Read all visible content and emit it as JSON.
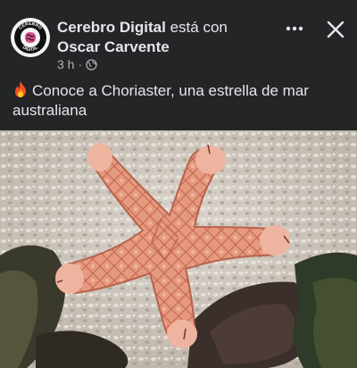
{
  "post": {
    "author": "Cerebro Digital",
    "with_text": "está con",
    "tagged": "Oscar Carvente",
    "time": "3 h",
    "dot": "·",
    "caption": "Conoce a Choriaster, una estrella de mar australiana"
  },
  "avatar": {
    "logo_top": "CEREBRO",
    "logo_bottom": "DIGITAL"
  },
  "icons": {
    "more": "more-options-icon",
    "close": "close-icon",
    "audience": "globe-icon",
    "emoji": "fire-emoji"
  },
  "colors": {
    "background": "#242526",
    "text": "#e4e6eb",
    "secondary_text": "#b0b3b8",
    "starfish": "#e89a7e"
  }
}
